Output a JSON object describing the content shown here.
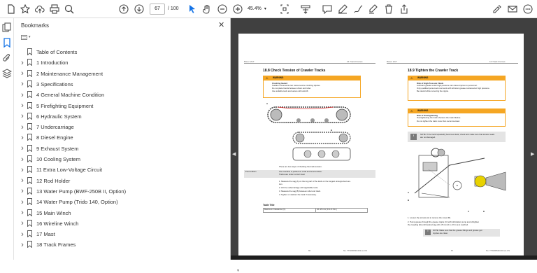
{
  "toolbar": {
    "current_page": "67",
    "total_pages": "/ 100",
    "zoom": "45.4%"
  },
  "bookmarks_panel": {
    "title": "Bookmarks",
    "close_label": "✕",
    "items": [
      {
        "label": "Table of Contents",
        "expandable": false
      },
      {
        "label": "1 Introduction",
        "expandable": true
      },
      {
        "label": "2 Maintenance Management",
        "expandable": true
      },
      {
        "label": "3 Specifications",
        "expandable": true
      },
      {
        "label": "4 General Machine Condition",
        "expandable": true
      },
      {
        "label": "5 Firefighting Equipment",
        "expandable": true
      },
      {
        "label": "6 Hydraulic System",
        "expandable": true
      },
      {
        "label": "7 Undercarriage",
        "expandable": true
      },
      {
        "label": "8 Diesel Engine",
        "expandable": true
      },
      {
        "label": "9 Exhaust System",
        "expandable": true
      },
      {
        "label": "10 Cooling System",
        "expandable": true
      },
      {
        "label": "11 Extra Low-Voltage Circuit",
        "expandable": true
      },
      {
        "label": "12 Rod Holder",
        "expandable": true
      },
      {
        "label": "13 Water Pump (BWF-250B II, Option)",
        "expandable": true
      },
      {
        "label": "14 Water Pump (Trido 140, Option)",
        "expandable": true
      },
      {
        "label": "15 Main Winch",
        "expandable": true
      },
      {
        "label": "16 Wireline Winch",
        "expandable": true
      },
      {
        "label": "17 Mast",
        "expandable": true
      },
      {
        "label": "18 Track Frames",
        "expandable": true
      }
    ]
  },
  "document": {
    "left_page": {
      "header_left": "Bauer 2GT",
      "header_right": "16 Track Frames",
      "section_title": "18.8  Check Tension of Crawler Tracks",
      "warning_label": "WARNING",
      "warning_heading": "Crushing hazard",
      "warning_line1": "Sudden movements can cause severe crushing injuries.",
      "warning_bullet1": "Do not place hands between chain and roller.",
      "warning_bullet2": "Use suitable tools and secure with anti-lift.",
      "label_a": "A",
      "label_b": "B",
      "intro_text": "There are two ways of checking the track tension.",
      "precondition_label": "Precondition",
      "precondition1": "The machine is parked on a flat and level surface.",
      "precondition2": "Tracks are under correct load.",
      "step1": "1.   Measure the sag (A) on the top part of the track on the longest unsupported sec-",
      "step1b": "      tion.",
      "step2": "2.   Lift the undercarriage with applicable tools.",
      "step3": "3.   Measure the sag (B) between roller and track.",
      "step4": "4.   Tighten or slacken the track if necessary.",
      "table_title": "Table Title",
      "table_col1": "Maximum Clearance (C)",
      "table_col2": "10–15 mm (0.4–0.6 in.)",
      "footer_left": "66",
      "footer_right": "No. TTS000520-002 en-US"
    },
    "right_page": {
      "header_left": "Bauer 2GT",
      "header_right": "16 Track Frames",
      "section_title": "18.9  Tighten the Crawler Track",
      "warning1_label": "WARNING",
      "warning1_heading": "Risk of High-Pressure Fluids",
      "warning1_line1": "Lubricant grease under high pressure can cause injuries to personnel.",
      "warning1_bullet1": "Only qualified personnel must work with lubricant grease contained at high pressure.",
      "warning1_bullet2": "Be careful while removing the nipple.",
      "warning2_label": "WARNING",
      "warning2_heading": "Risk of Overtightening",
      "warning2_line1": "Overtightening the track shortens the track lifetime.",
      "warning2_bullet1": "Do not tighten the track more than recommended.",
      "note_label": "!",
      "note_text": "NOTE: If the track repeatedly becomes slack, check and make sure that tension seals",
      "note_text2": "are not damaged.",
      "fig_labels": [
        "A",
        "B",
        "C",
        "D",
        "E"
      ],
      "step1": "1.   Loosen the screws (A) to remove the cover (B).",
      "step2": "2.   Pump grease through the grease nipple (C) with lubrication pump and oil tighten",
      "step2b": "      the coupling (D) until desired sag (10–15 mm (0.4–0.6 in.)) is reached.",
      "note2_text": "NOTE: Make sure that the grease fittings and grease gun",
      "note2_text2": "nipples are clean.",
      "footer_left": "67",
      "footer_right": "No. TTS000520-002 en-US"
    }
  },
  "colors": {
    "warning": "#f5a623",
    "viewer_bg": "#404040",
    "accent_blue": "#1473e6"
  }
}
